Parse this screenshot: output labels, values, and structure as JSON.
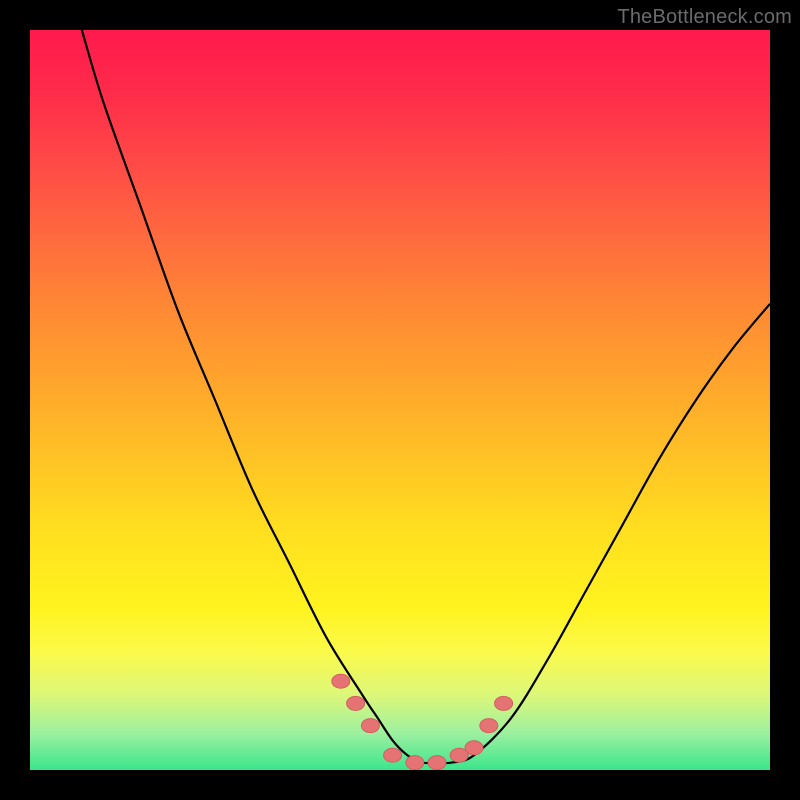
{
  "watermark": "TheBottleneck.com",
  "colors": {
    "frame": "#000000",
    "curve": "#000000",
    "marker_fill": "#e57373",
    "marker_stroke": "#d36060",
    "gradient_top": "#ff1a4d",
    "gradient_bottom": "#3be58c"
  },
  "chart_data": {
    "type": "line",
    "title": "",
    "xlabel": "",
    "ylabel": "",
    "xlim": [
      0,
      100
    ],
    "ylim": [
      0,
      100
    ],
    "legend": false,
    "grid": false,
    "series": [
      {
        "name": "curve",
        "x": [
          7,
          10,
          15,
          20,
          25,
          30,
          35,
          40,
          45,
          47,
          49,
          51,
          53,
          55,
          57,
          60,
          65,
          70,
          75,
          80,
          85,
          90,
          95,
          100
        ],
        "y": [
          100,
          90,
          76,
          62,
          50,
          38,
          28,
          18,
          10,
          7,
          4,
          2,
          1,
          1,
          1,
          2,
          7,
          15,
          24,
          33,
          42,
          50,
          57,
          63
        ]
      }
    ],
    "markers": {
      "name": "highlight-points",
      "x": [
        42,
        44,
        46,
        49,
        52,
        55,
        58,
        60,
        62,
        64
      ],
      "y": [
        12,
        9,
        6,
        2,
        1,
        1,
        2,
        3,
        6,
        9
      ]
    }
  }
}
